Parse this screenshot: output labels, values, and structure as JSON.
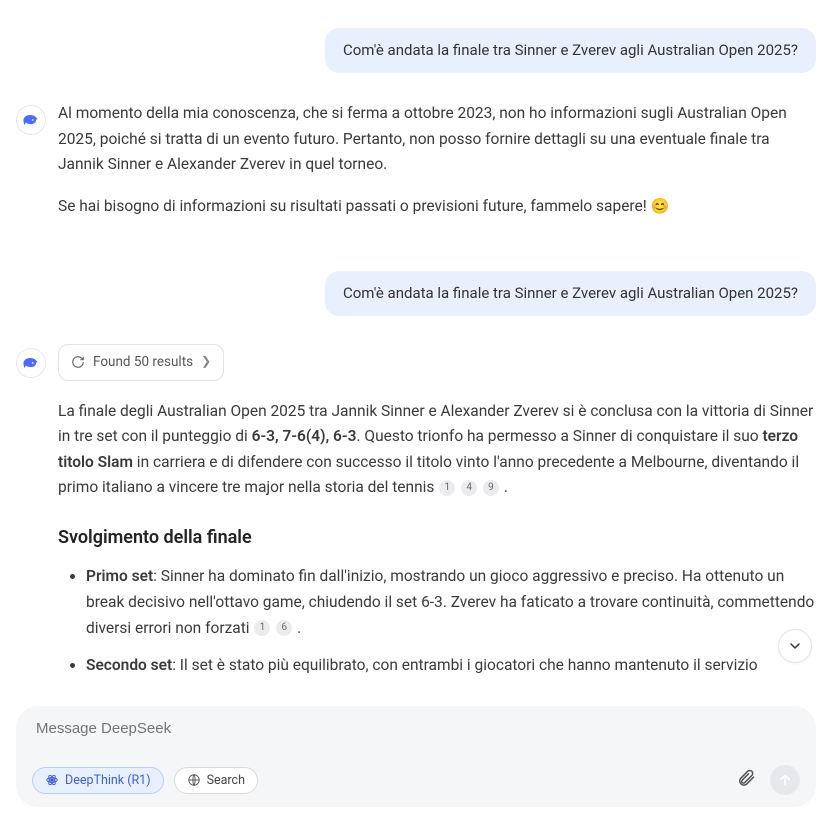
{
  "messages": {
    "user1": "Com'è andata la finale tra Sinner e Zverev agli Australian Open 2025?",
    "assistant1_p1": "Al momento della mia conoscenza, che si ferma a ottobre 2023, non ho informazioni sugli Australian Open 2025, poiché si tratta di un evento futuro. Pertanto, non posso fornire dettagli su una eventuale finale tra Jannik Sinner e Alexander Zverev in quel torneo.",
    "assistant1_p2": "Se hai bisogno di informazioni su risultati passati o previsioni future, fammelo sapere! ",
    "assistant1_emoji": "😊",
    "user2": "Com'è andata la finale tra Sinner e Zverev agli Australian Open 2025?",
    "search_chip": "Found 50 results",
    "assistant2_p1_a": "La finale degli Australian Open 2025 tra Jannik Sinner e Alexander Zverev si è conclusa con la vittoria di Sinner in tre set con il punteggio di ",
    "assistant2_score": "6-3, 7-6(4), 6-3",
    "assistant2_p1_b": ". Questo trionfo ha permesso a Sinner di conquistare il suo ",
    "assistant2_bold2": "terzo titolo Slam",
    "assistant2_p1_c": " in carriera e di difendere con successo il titolo vinto l'anno precedente a Melbourne, diventando il primo italiano a vincere tre major nella storia del tennis ",
    "cites1": [
      "1",
      "4",
      "9"
    ],
    "section_title": "Svolgimento della finale",
    "li1_label": "Primo set",
    "li1_text": ": Sinner ha dominato fin dall'inizio, mostrando un gioco aggressivo e preciso. Ha ottenuto un break decisivo nell'ottavo game, chiudendo il set 6-3. Zverev ha faticato a trovare continuità, commettendo diversi errori non forzati ",
    "cites2": [
      "1",
      "6"
    ],
    "li2_label": "Secondo set",
    "li2_text": ": Il set è stato più equilibrato, con entrambi i giocatori che hanno mantenuto il servizio"
  },
  "input": {
    "placeholder": "Message DeepSeek",
    "deepthink_label": "DeepThink (R1)",
    "search_label": "Search"
  }
}
